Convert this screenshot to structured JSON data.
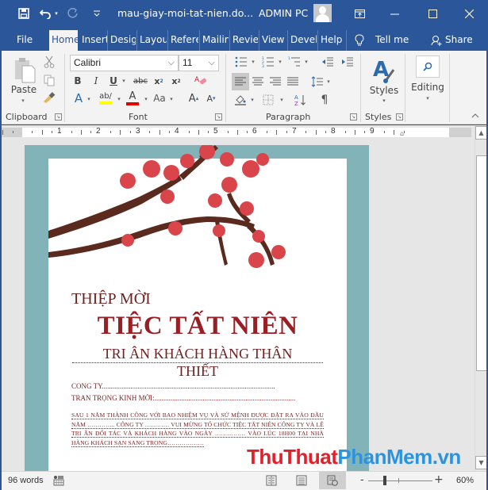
{
  "titlebar": {
    "doc_title": "mau-giay-moi-tat-nien.do...",
    "user_name": "ADMIN PC",
    "icons": [
      "save-icon",
      "undo-icon",
      "redo-icon",
      "customize-qat-icon",
      "ribbon-display-options-icon",
      "minimize-icon",
      "maximize-icon",
      "close-icon"
    ]
  },
  "tabs": [
    {
      "label": "File"
    },
    {
      "label": "Home",
      "active": true
    },
    {
      "label": "Insert"
    },
    {
      "label": "Design"
    },
    {
      "label": "Layout"
    },
    {
      "label": "References"
    },
    {
      "label": "Mailings"
    },
    {
      "label": "Review"
    },
    {
      "label": "View"
    },
    {
      "label": "Developer"
    },
    {
      "label": "Help"
    }
  ],
  "tell_me": "Tell me",
  "share": "Share",
  "ribbon": {
    "clipboard": {
      "label": "Clipboard",
      "paste": "Paste"
    },
    "font": {
      "label": "Font",
      "font_name": "Calibri",
      "font_size": "11",
      "colors": {
        "highlight": "#ffff00",
        "font_color": "#e00000"
      }
    },
    "paragraph": {
      "label": "Paragraph"
    },
    "styles": {
      "label": "Styles",
      "button": "Styles"
    },
    "editing": {
      "button": "Editing"
    }
  },
  "ruler": {
    "numbers": [
      "1",
      "2",
      "3",
      "4",
      "5",
      "6",
      "7",
      "8",
      "9"
    ]
  },
  "document": {
    "heading_small": "THIỆP MỜI",
    "heading_big": "TIỆC TẤT NIÊN",
    "subheading_1": "TRI ÂN KHÁCH HÀNG THÂN",
    "subheading_2": "THIẾT",
    "field_company": "CONG TY.................................................................................................",
    "field_invite": "TRAN TRỌNG KINH MỜI:...............................................................................",
    "paragraph": "SAU 1 NĂM THÀNH CÔNG VỚI BAO NHIỆM VỤ VÀ SỨ MỆNH ĐƯỢC ĐẶT RA VÀO ĐẦU NĂM ………….. CÔNG TY ………… VUI MỪNG TỔ CHỨC TIỆC TẤT NIÊN CÔNG TY VÀ LỄ TRI ÂN ĐỐI TÁC VÀ KHÁCH HÀNG VÀO NGÀY …………… VÀO LÚC 18H00 TẠI NHÀ HÀNG KHÁCH SẠN SANG TRỌNG………………",
    "colors": {
      "page_border": "#81b3b9",
      "heading": "#9a1f24",
      "text": "#6e1f1f",
      "blossom": "#d9454a",
      "branch": "#5a2a1e"
    }
  },
  "watermark": {
    "part1": "ThuThuat",
    "part2": "PhanMem.vn"
  },
  "status": {
    "word_count": "96 words",
    "zoom_level": "60%",
    "zoom_percent": 60
  },
  "theme": {
    "accent": "#2b579a",
    "ribbon_bg": "#f3f3f3"
  }
}
